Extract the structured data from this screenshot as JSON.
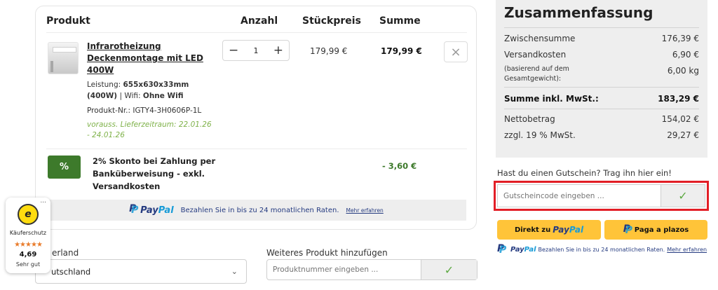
{
  "cart": {
    "headers": {
      "product": "Produkt",
      "quantity": "Anzahl",
      "unit_price": "Stückpreis",
      "total": "Summe"
    },
    "item": {
      "title_lines": [
        "Infrarotheizung",
        "Deckenmontage mit LED",
        "400W"
      ],
      "leistung_label": "Leistung:",
      "leistung_value": "655x630x33mm",
      "leistung_value2": "(400W)",
      "wifi_sep": "| Wifi:",
      "wifi_value": "Ohne Wifi",
      "product_no": "Produkt-Nr.: IGTY4-3H0606P-1L",
      "delivery_line1": "vorauss. Lieferzeitraum: 22.01.26",
      "delivery_line2": "- 24.01.26",
      "quantity": "1",
      "minus": "−",
      "plus": "+",
      "unit_price": "179,99 €",
      "total": "179,99 €",
      "remove": "×"
    },
    "discount": {
      "badge": "%",
      "lines": [
        "2% Skonto bei Zahlung per",
        "Banküberweisung - exkl.",
        "Versandkosten"
      ],
      "value": "- 3,60 €"
    },
    "paypal_bar": {
      "brand_a": "Pay",
      "brand_b": "Pal",
      "text": "Bezahlen Sie in bis zu 24 monatlichen Raten.",
      "link": "Mehr erfahren"
    }
  },
  "lower": {
    "country_label": "erland",
    "country_value": "utschland",
    "add_label": "Weiteres Produkt hinzufügen",
    "add_placeholder": "Produktnummer eingeben ...",
    "check": "✓",
    "chevron": "⌄"
  },
  "trust": {
    "dots": "...",
    "seal": "e",
    "label": "Käuferschutz",
    "stars": "★★★★★",
    "rating": 4.69,
    "score": "4,69",
    "verdict": "Sehr gut"
  },
  "summary": {
    "title": "Zusammenfassung",
    "subtotal_label": "Zwischensumme",
    "subtotal": "176,39 €",
    "shipping_label": "Versandkosten",
    "shipping": "6,90 €",
    "weight_note_1": "(basierend auf dem",
    "weight_note_2": "Gesamtgewicht):",
    "weight": "6,00 kg",
    "total_label": "Summe inkl. MwSt.:",
    "total": "183,29 €",
    "net_label": "Nettobetrag",
    "net": "154,02 €",
    "vat_label": "zzgl. 19 % MwSt.",
    "vat": "29,27 €"
  },
  "voucher": {
    "label": "Hast du einen Gutschein? Trag ihn hier ein!",
    "placeholder": "Gutscheincode eingeben ...",
    "apply": "✓"
  },
  "checkout": {
    "direct_prefix": "Direkt zu",
    "direct_brand_a": "Pay",
    "direct_brand_b": "Pal",
    "installment_label": "Paga a plazos",
    "pp_brand_a": "Pay",
    "pp_brand_b": "Pal",
    "pp_text": "Bezahlen Sie in bis zu 24 monatlichen Raten.",
    "pp_link": "Mehr erfahren"
  },
  "colors": {
    "accent_green": "#3d7a2b",
    "check_green": "#5da942",
    "paypal_yellow": "#ffc439",
    "highlight_red": "#e21e26",
    "summary_bg": "#eeeeee"
  }
}
